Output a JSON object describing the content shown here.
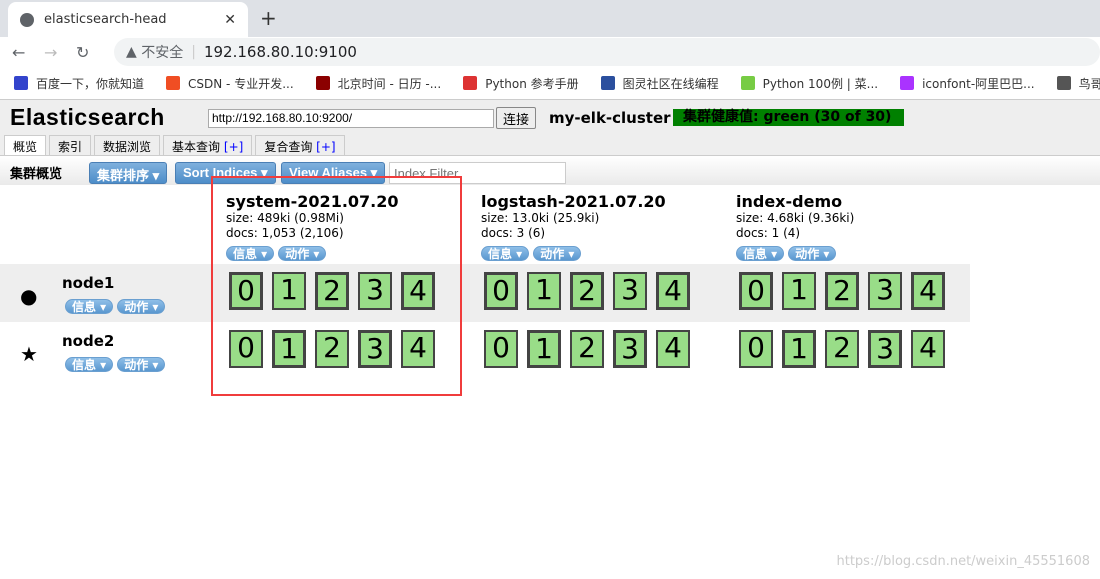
{
  "browser": {
    "tab_title": "elasticsearch-head",
    "security": "不安全",
    "url": "192.168.80.10:9100",
    "bookmarks": [
      "百度一下，你就知道",
      "CSDN - 专业开发...",
      "北京时间 - 日历 -...",
      "Python 参考手册",
      "图灵社区在线编程",
      "Python 100例 | 菜...",
      "iconfont-阿里巴巴...",
      "鸟哥的Linu"
    ]
  },
  "app": {
    "logo": "Elasticsearch",
    "connect_url": "http://192.168.80.10:9200/",
    "connect_label": "连接",
    "cluster_name": "my-elk-cluster",
    "health": "集群健康值: green (30 of 30)",
    "health_color": "#008000",
    "tabs": [
      {
        "label": "概览"
      },
      {
        "label": "索引"
      },
      {
        "label": "数据浏览"
      },
      {
        "label": "基本查询",
        "plus": "[+]"
      },
      {
        "label": "复合查询",
        "plus": "[+]"
      }
    ]
  },
  "toolbar": {
    "title": "集群概览",
    "sort_cluster": "集群排序 ▾",
    "sort_indices": "Sort Indices ▾",
    "view_aliases": "View Aliases ▾",
    "filter_placeholder": "Index Filter"
  },
  "menu": {
    "info": "信息 ▾",
    "action": "动作 ▾"
  },
  "indices": [
    {
      "name": "system-2021.07.20",
      "size": "size: 489ki (0.98Mi)",
      "docs": "docs: 1,053 (2,106)"
    },
    {
      "name": "logstash-2021.07.20",
      "size": "size: 13.0ki (25.9ki)",
      "docs": "docs: 3 (6)"
    },
    {
      "name": "index-demo",
      "size": "size: 4.68ki (9.36ki)",
      "docs": "docs: 1 (4)"
    }
  ],
  "nodes": [
    {
      "name": "node1",
      "icon": "circle-icon",
      "glyph": "●",
      "primary_shards": [
        0,
        2,
        4
      ]
    },
    {
      "name": "node2",
      "icon": "star-icon",
      "glyph": "★",
      "primary_shards": [
        1,
        3
      ]
    }
  ],
  "shards": [
    "0",
    "1",
    "2",
    "3",
    "4"
  ],
  "watermark": "https://blog.csdn.net/weixin_45551608"
}
